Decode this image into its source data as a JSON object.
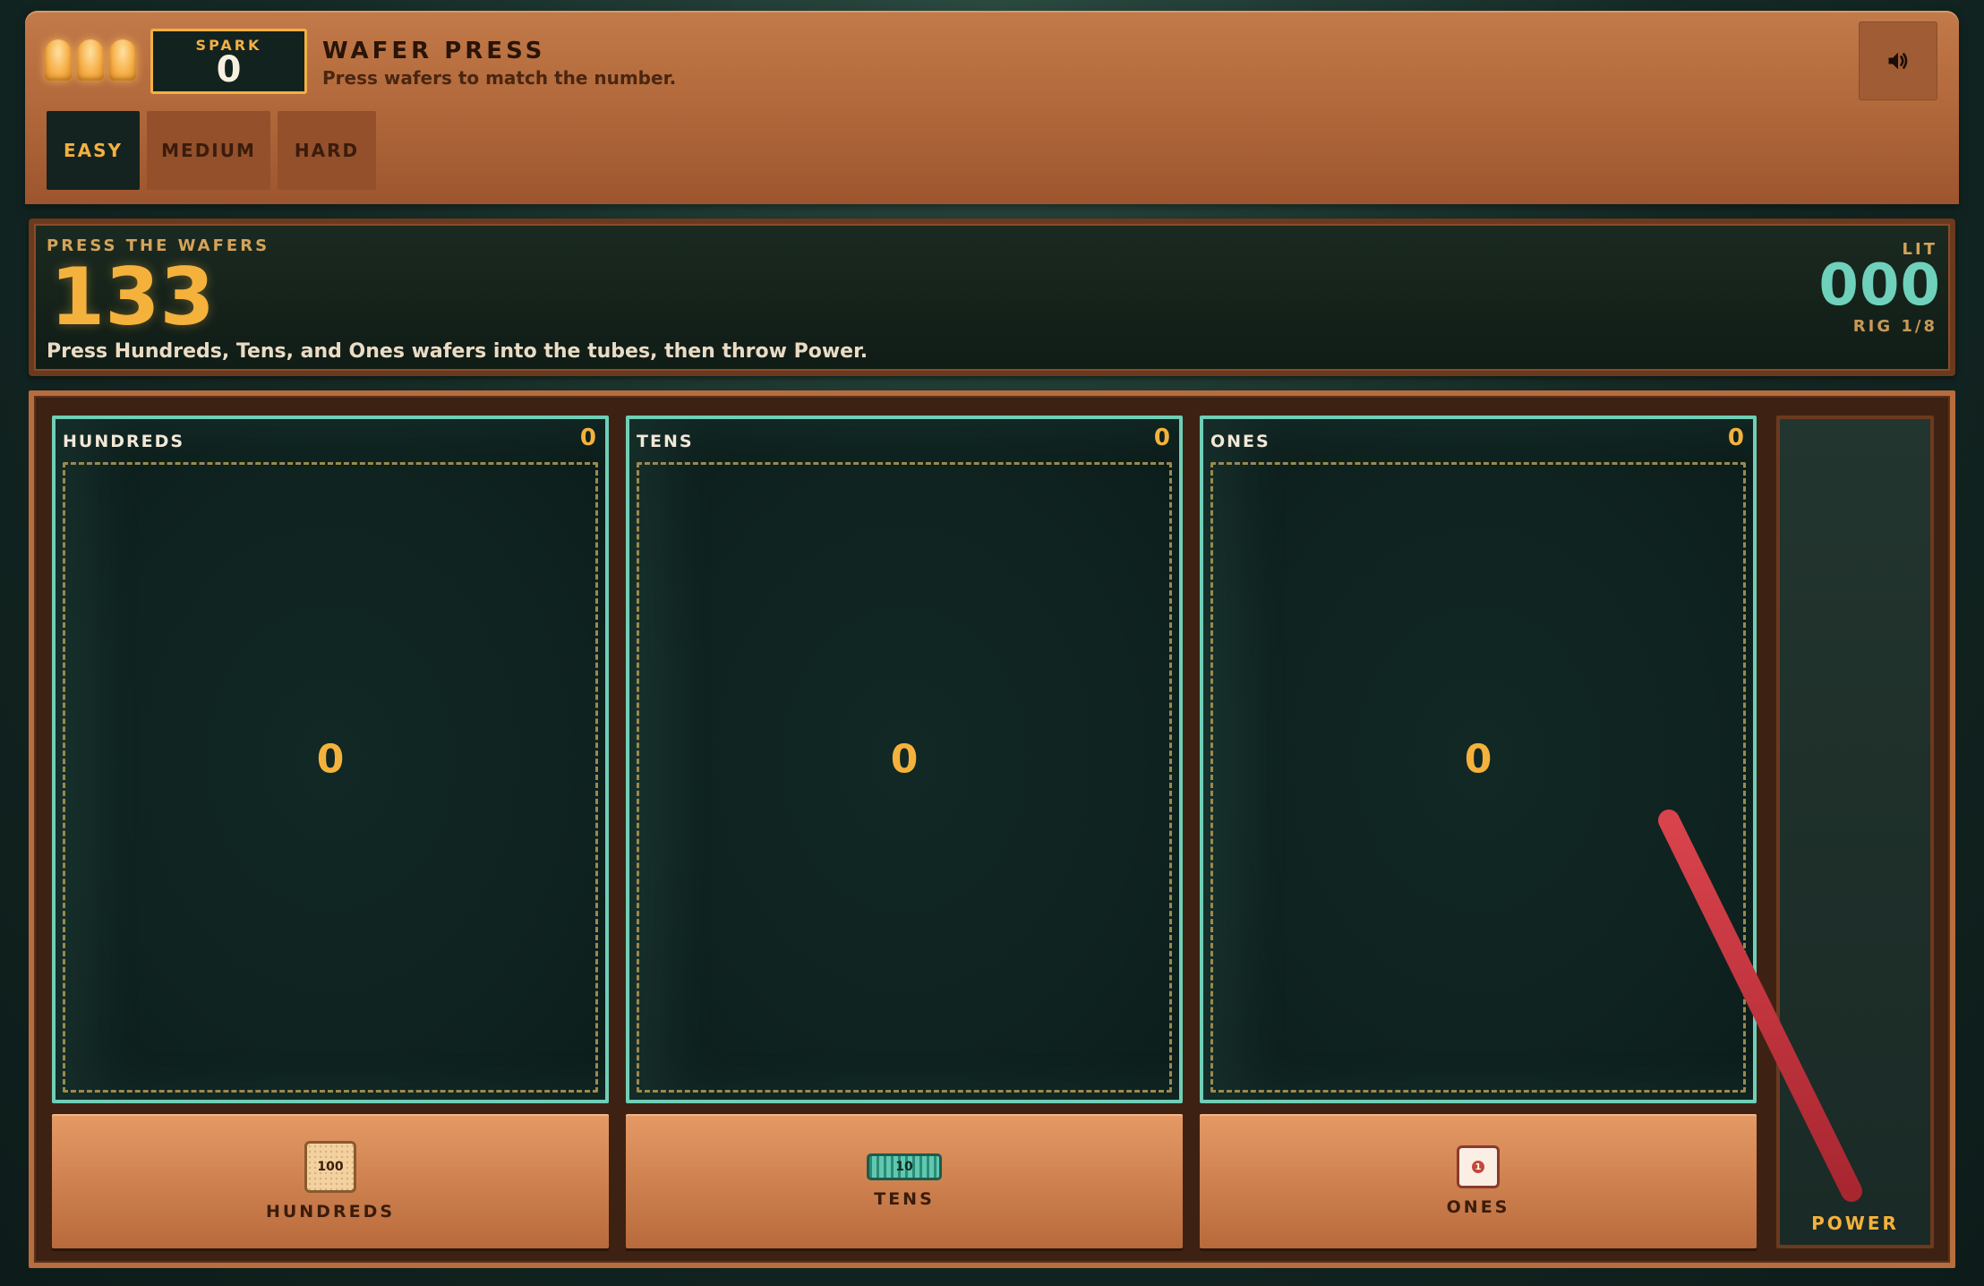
{
  "header": {
    "lives_count": 3,
    "spark_label": "SPARK",
    "spark_value": "0",
    "title": "WAFER PRESS",
    "subtitle": "Press wafers to match the number.",
    "sound_icon": "speaker-icon",
    "difficulty": [
      {
        "label": "EASY",
        "active": true
      },
      {
        "label": "MEDIUM",
        "active": false
      },
      {
        "label": "HARD",
        "active": false
      }
    ]
  },
  "target": {
    "label": "PRESS THE WAFERS",
    "number": "133",
    "instructions": "Press Hundreds, Tens, and Ones wafers into the tubes, then throw Power.",
    "lit_label": "LIT",
    "lit_value": "000",
    "rig_label": "RIG 1/8"
  },
  "tubes": [
    {
      "name": "HUNDREDS",
      "count": "0",
      "value": "0"
    },
    {
      "name": "TENS",
      "count": "0",
      "value": "0"
    },
    {
      "name": "ONES",
      "count": "0",
      "value": "0"
    }
  ],
  "wafers": [
    {
      "label": "HUNDREDS",
      "chip_text": "100"
    },
    {
      "label": "TENS",
      "chip_text": "10"
    },
    {
      "label": "ONES",
      "chip_text": "1"
    }
  ],
  "power": {
    "label": "POWER"
  },
  "colors": {
    "accent": "#f4b23c",
    "teal": "#6fcfb6",
    "copper": "#c37a4a",
    "lever": "#d4404a"
  }
}
